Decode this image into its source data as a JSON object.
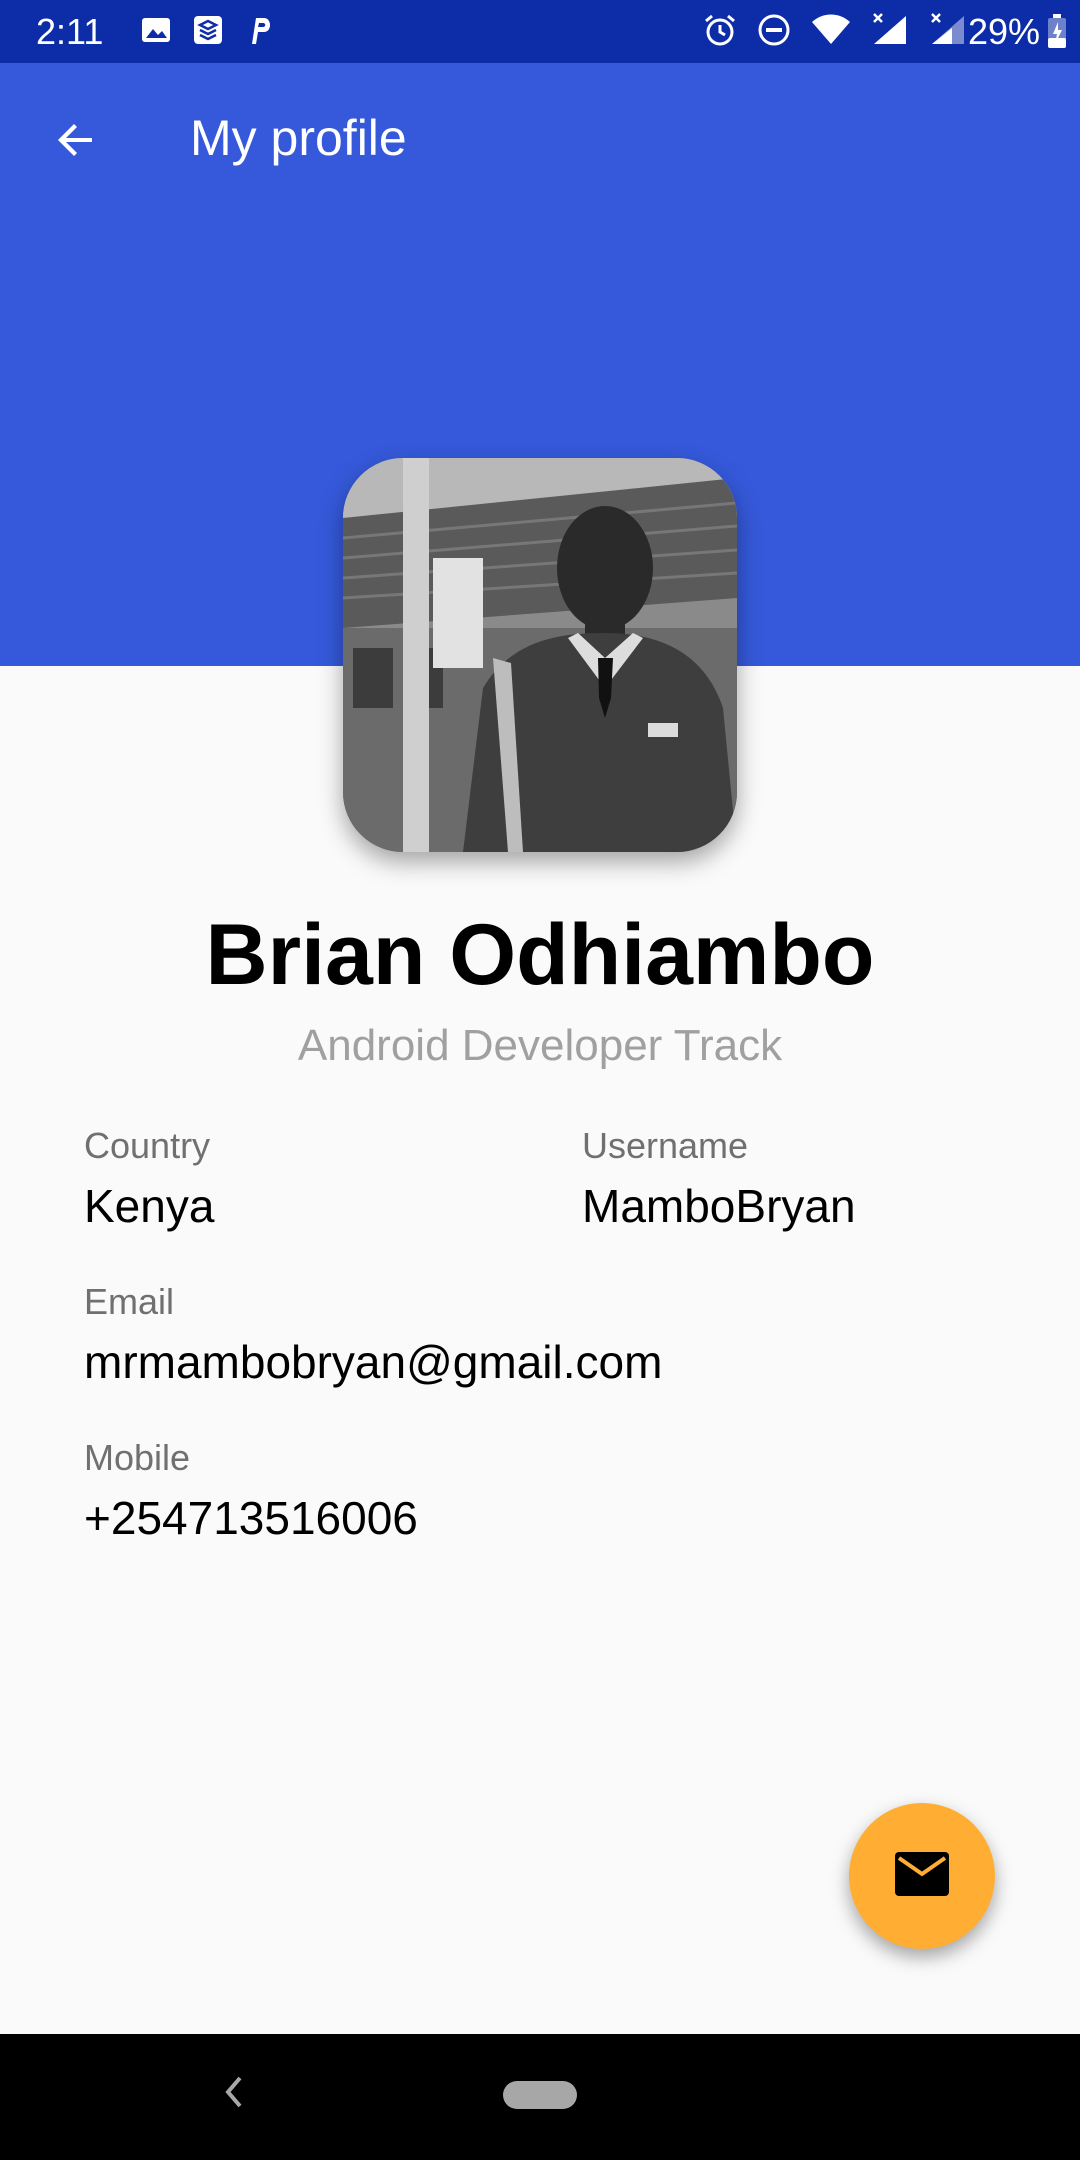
{
  "status_bar": {
    "time": "2:11",
    "battery": "29%",
    "left_icons": [
      "image-icon",
      "stack-icon",
      "p-icon"
    ],
    "right_icons": [
      "alarm-icon",
      "do-not-disturb-icon",
      "wifi-icon",
      "signal-icon",
      "signal-icon"
    ]
  },
  "app_bar": {
    "title": "My profile",
    "back_icon": "arrow-left-icon"
  },
  "profile": {
    "name": "Brian Odhiambo",
    "track": "Android Developer Track"
  },
  "fields": {
    "country": {
      "label": "Country",
      "value": "Kenya"
    },
    "username": {
      "label": "Username",
      "value": "MamboBryan"
    },
    "email": {
      "label": "Email",
      "value": "mrmambobryan@gmail.com"
    },
    "mobile": {
      "label": "Mobile",
      "value": "+254713516006"
    }
  },
  "fab": {
    "icon": "mail-icon"
  },
  "colors": {
    "status_bar": "#0D2DA8",
    "app_bar": "#3559DA",
    "background": "#FAFAFA",
    "fab": "#FFAE33",
    "subtitle": "#A0A0A0",
    "label": "#707070"
  }
}
